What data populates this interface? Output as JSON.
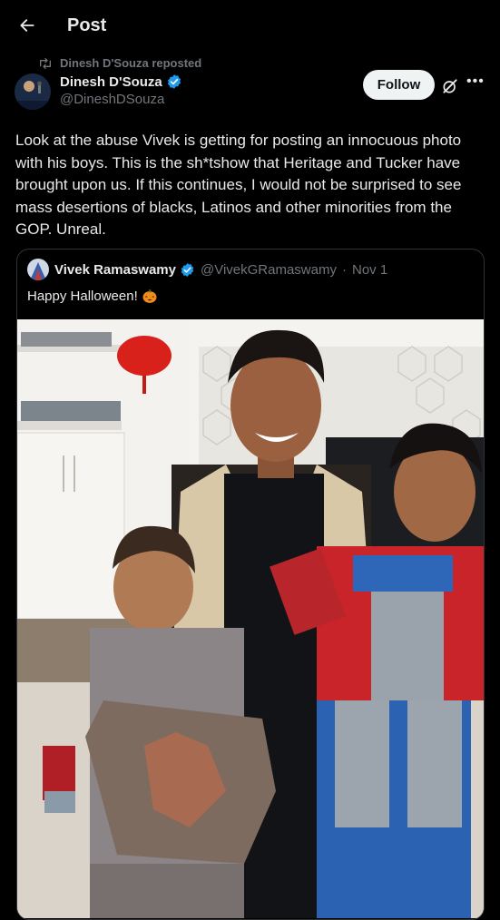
{
  "header": {
    "title": "Post",
    "back_icon": "arrow-left-icon"
  },
  "repost": {
    "label": "Dinesh D'Souza reposted",
    "icon": "repost-icon"
  },
  "author": {
    "name": "Dinesh D'Souza",
    "handle": "@DineshDSouza",
    "verified": true,
    "follow_label": "Follow",
    "grok_icon": "grok-icon",
    "more_icon": "more-icon"
  },
  "post": {
    "text": "Look at the abuse Vivek is getting for posting an innocuous photo with his boys. This is the sh*tshow that Heritage and Tucker have brought upon us. If this continues, I would not be surprised to see mass desertions of blacks, Latinos and other minorities from the GOP. Unreal."
  },
  "quote": {
    "name": "Vivek Ramaswamy",
    "handle": "@VivekGRamaswamy",
    "separator": "·",
    "date": "Nov 1",
    "verified": true,
    "text": "Happy Halloween!",
    "emoji": "pumpkin-icon"
  },
  "colors": {
    "background": "#000000",
    "text": "#e7e9ea",
    "muted": "#71767b",
    "verified": "#1d9bf0",
    "border": "#2f3336"
  }
}
